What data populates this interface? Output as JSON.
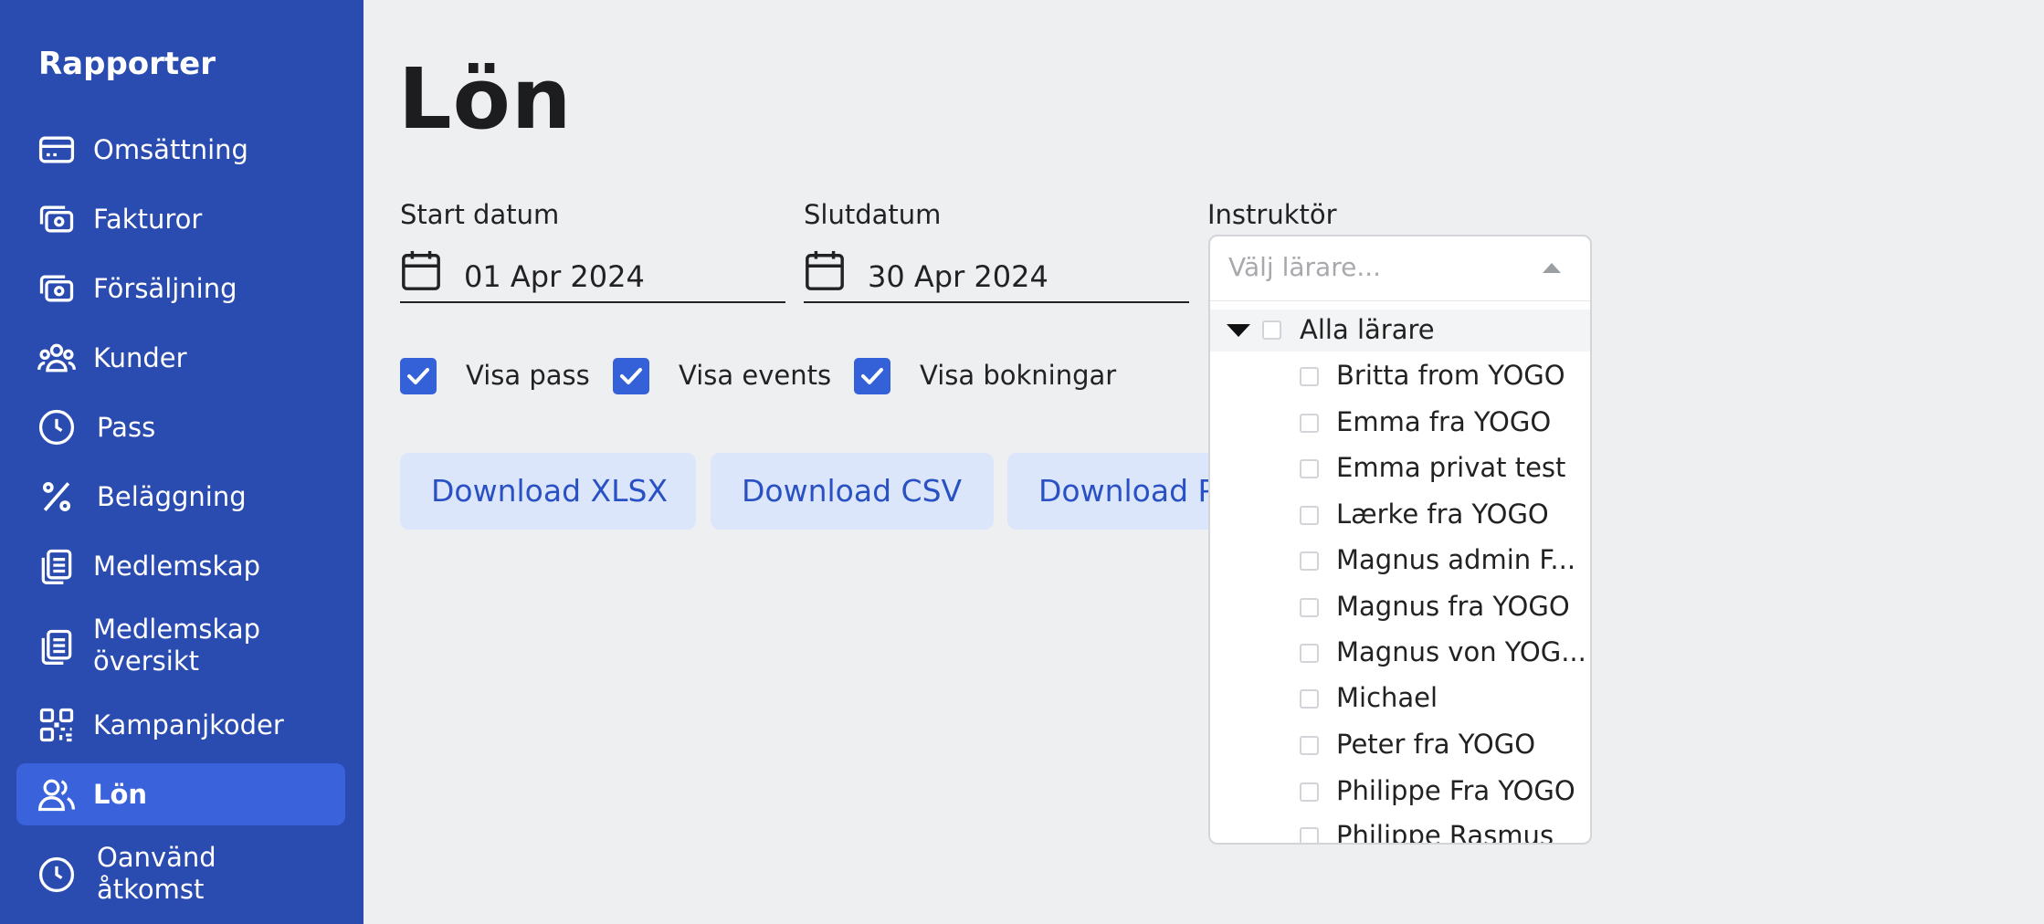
{
  "sidebar": {
    "title": "Rapporter",
    "items": [
      {
        "label": "Omsättning",
        "icon": "credit-card-icon"
      },
      {
        "label": "Fakturor",
        "icon": "money-icon"
      },
      {
        "label": "Försäljning",
        "icon": "money-icon"
      },
      {
        "label": "Kunder",
        "icon": "users-group-icon"
      },
      {
        "label": "Pass",
        "icon": "clock-icon"
      },
      {
        "label": "Beläggning",
        "icon": "percent-icon"
      },
      {
        "label": "Medlemskap",
        "icon": "clipboard-icon"
      },
      {
        "label": "Medlemskap översikt",
        "icon": "clipboard-icon"
      },
      {
        "label": "Kampanjkoder",
        "icon": "qr-code-icon"
      },
      {
        "label": "Lön",
        "icon": "users-icon",
        "active": true
      },
      {
        "label": "Oanvänd åtkomst",
        "icon": "clock-icon"
      }
    ]
  },
  "main": {
    "title": "Lön",
    "start_label": "Start datum",
    "start_value": "01 Apr 2024",
    "end_label": "Slutdatum",
    "end_value": "30 Apr 2024",
    "instructor_label": "Instruktör",
    "checkboxes": [
      {
        "label": "Visa pass",
        "checked": true
      },
      {
        "label": "Visa events",
        "checked": true
      },
      {
        "label": "Visa bokningar",
        "checked": true
      }
    ],
    "buttons": [
      "Download XLSX",
      "Download CSV",
      "Download P"
    ]
  },
  "dropdown": {
    "placeholder": "Välj lärare...",
    "all_label": "Alla lärare",
    "options": [
      "Britta from YOGO",
      "Emma fra YOGO",
      "Emma privat test",
      "Lærke fra YOGO",
      "Magnus admin F...",
      "Magnus fra YOGO",
      "Magnus von YOG...",
      "Michael",
      "Peter fra YOGO",
      "Philippe Fra YOGO",
      "Philippe Rasmus"
    ]
  },
  "colors": {
    "sidebar_bg": "#2a4bb0",
    "sidebar_active": "#3a62db",
    "accent": "#3460d8",
    "button_bg": "#dbe6fa",
    "button_text": "#2a51c4",
    "page_bg": "#eeeff1"
  }
}
